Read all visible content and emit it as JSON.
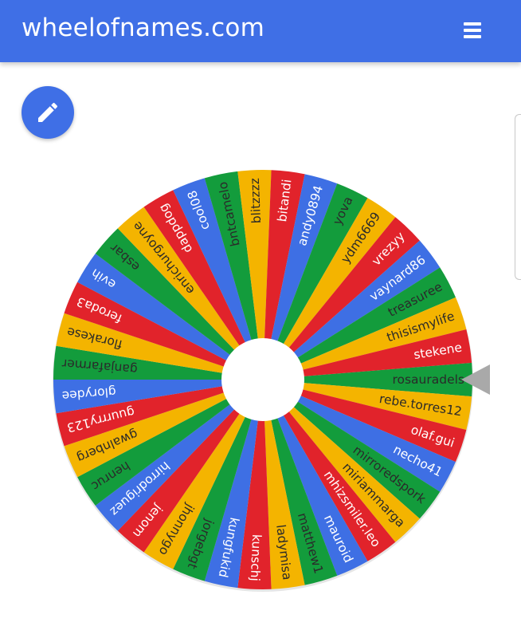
{
  "header": {
    "title": "wheelofnames.com",
    "menu_icon": "hamburger-menu-icon"
  },
  "edit_button": {
    "icon": "pencil-icon"
  },
  "wheel": {
    "colors": [
      "#3e6fe4",
      "#139c3c",
      "#f4b400",
      "#e1232b"
    ],
    "label_colors": {
      "#3e6fe4": "#ffffff",
      "#139c3c": "#2a2a2a",
      "#f4b400": "#2a2a2a",
      "#e1232b": "#ffffff"
    },
    "pointer_color": "#a9a9a9",
    "entries": [
      "rosauradels",
      "rebe.torres12",
      "olaf.gui",
      "necho41",
      "mirroredspork",
      "miriammarga",
      "mhizsmiler.leo",
      "mauroid",
      "matthew1",
      "ladymisa",
      "kunschj",
      "kungfukid",
      "jorgebgt",
      "jhonnygo",
      "jenom",
      "hirrodriguez",
      "henruc",
      "gwalnberg",
      "guurrry123",
      "glorydee",
      "ganjafarmer",
      "florakese",
      "feroda3",
      "evih",
      "esbar",
      "enrichurgoyne",
      "dappdog",
      "cool08",
      "bntcamelo",
      "blitzzzz",
      "bitandi",
      "andy0894",
      "yova",
      "ydm6669",
      "vrezyy",
      "vaynard86",
      "treasuree",
      "thisismylife",
      "stekene"
    ]
  }
}
